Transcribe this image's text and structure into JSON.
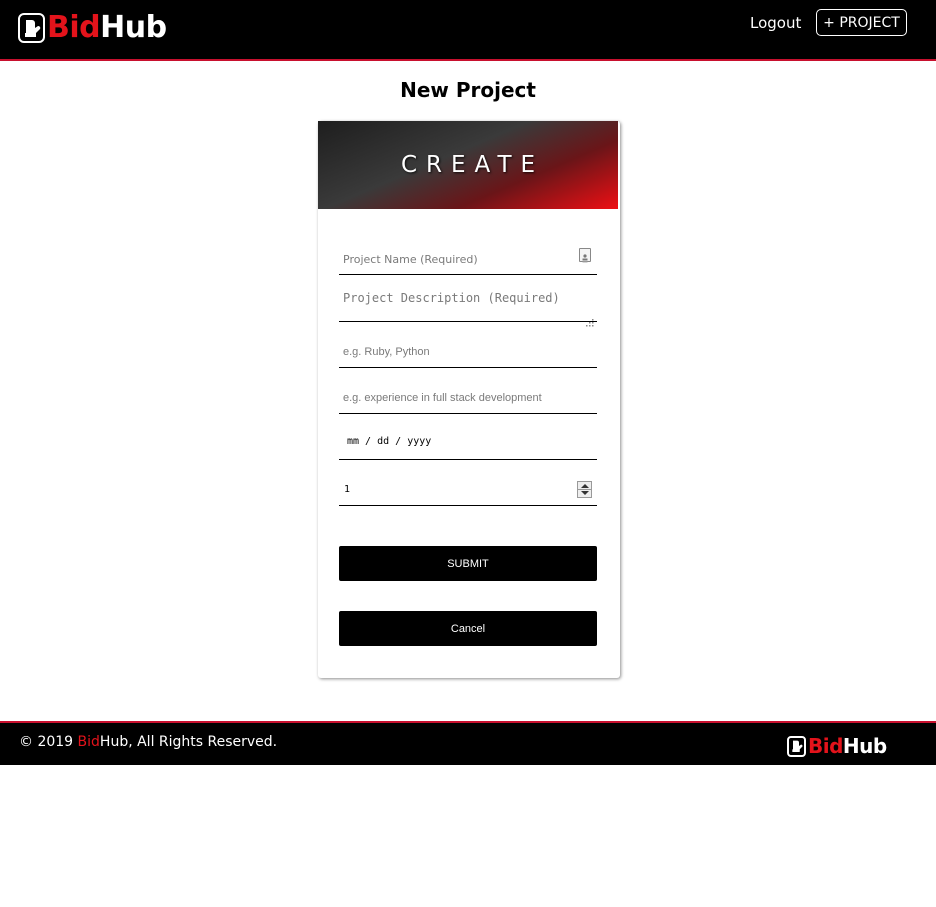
{
  "header": {
    "logo": {
      "part1": "Bid",
      "part2": "Hub",
      "icon": "mitten-icon"
    },
    "nav": {
      "logout": "Logout",
      "project_button": "+ PROJECT"
    }
  },
  "page": {
    "title": "New Project"
  },
  "card": {
    "banner": "CREATE",
    "fields": {
      "name_placeholder": "Project Name (Required)",
      "description_placeholder": "Project Description (Required)",
      "skills_placeholder": "e.g. Ruby, Python",
      "experience_placeholder": "e.g. experience in full stack development",
      "date_placeholder": "mm / dd / yyyy",
      "number_value": "1"
    },
    "buttons": {
      "submit": "SUBMIT",
      "cancel": "Cancel"
    }
  },
  "footer": {
    "copyright_prefix": "© 2019 ",
    "copyright_bid": "Bid",
    "copyright_suffix": "Hub, All Rights Reserved.",
    "logo": {
      "part1": "Bid",
      "part2": "Hub"
    }
  },
  "colors": {
    "brand_red": "#e3131b",
    "header_bg": "#000000",
    "accent_line": "#c8102e"
  }
}
